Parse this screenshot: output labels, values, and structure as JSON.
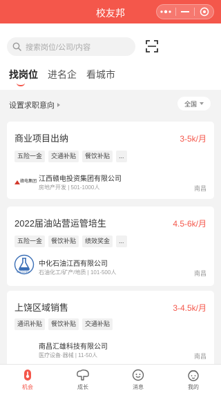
{
  "app": {
    "title": "校友邦"
  },
  "search": {
    "placeholder": "搜索岗位/公司/内容"
  },
  "tabs": [
    {
      "label": "找岗位",
      "active": true
    },
    {
      "label": "进名企",
      "active": false
    },
    {
      "label": "看城市",
      "active": false
    }
  ],
  "filter": {
    "intent_label": "设置求职意向",
    "city_select": "全国"
  },
  "jobs": [
    {
      "title": "商业项目出纳",
      "salary": "3-5k/月",
      "tags": [
        "五险一金",
        "交通补贴",
        "餐饮补贴",
        "..."
      ],
      "company": "江西赣电投资集团有限公司",
      "meta": "房地产开发 | 501-1000人",
      "city": "南昌",
      "logo": {
        "icon": "ganjiang-group-logo",
        "text": "赣电集团"
      }
    },
    {
      "title": "2022届油站营运管培生",
      "salary": "4.5-6k/月",
      "tags": [
        "五险一金",
        "餐饮补贴",
        "绩效奖金",
        "..."
      ],
      "company": "中化石油江西有限公司",
      "meta": "石油化工/矿产/地质 | 101-500人",
      "city": "南昌",
      "logo": {
        "icon": "sinochem-flask-logo",
        "text": "SINOCHEM"
      }
    },
    {
      "title": "上饶区域销售",
      "salary": "3-4.5k/月",
      "tags": [
        "通讯补贴",
        "餐饮补贴",
        "交通补贴"
      ],
      "company": "南昌汇雄科技有限公司",
      "meta": "医疗设备·器械 | 11-50人",
      "city": "南昌"
    }
  ],
  "nav": [
    {
      "label": "机会",
      "icon": "opportunity-icon",
      "active": true
    },
    {
      "label": "成长",
      "icon": "growth-icon",
      "active": false
    },
    {
      "label": "消息",
      "icon": "message-icon",
      "active": false
    },
    {
      "label": "我的",
      "icon": "profile-icon",
      "active": false
    }
  ],
  "colors": {
    "brand": "#f4574b",
    "background": "#f3f3f3"
  }
}
